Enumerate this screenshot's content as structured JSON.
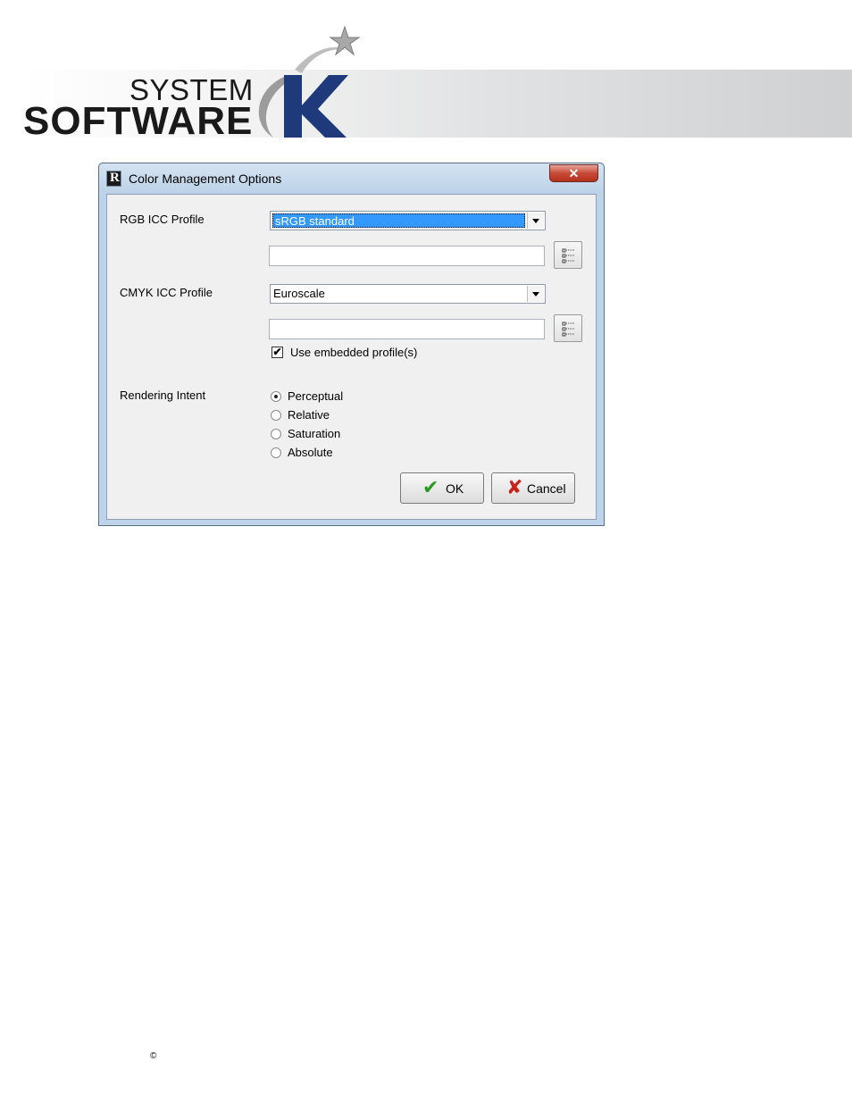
{
  "brand": {
    "line1": "SYSTEM",
    "line2": "SOFTWARE",
    "mark": "K",
    "colors": {
      "mark_blue": "#1e3a7b",
      "star_gray": "#9a9a9a"
    }
  },
  "dialog": {
    "title": "Color Management Options",
    "app_icon_letter": "R",
    "close_glyph": "✕",
    "rgb": {
      "label": "RGB ICC Profile",
      "selected": "sRGB standard",
      "path_value": ""
    },
    "cmyk": {
      "label": "CMYK ICC Profile",
      "selected": "Euroscale",
      "path_value": ""
    },
    "use_embedded": {
      "label": "Use embedded profile(s)",
      "checked": true,
      "mark": "✔"
    },
    "rendering_intent": {
      "label": "Rendering Intent",
      "options": [
        "Perceptual",
        "Relative",
        "Saturation",
        "Absolute"
      ],
      "selected": "Perceptual"
    },
    "buttons": {
      "ok": {
        "label": "OK",
        "icon": "checkmark-icon",
        "glyph": "✔",
        "color": "#2a9a1e"
      },
      "cancel": {
        "label": "Cancel",
        "icon": "x-icon",
        "glyph": "✘",
        "color": "#c8231a"
      }
    }
  },
  "footer": {
    "copyright": "©"
  }
}
